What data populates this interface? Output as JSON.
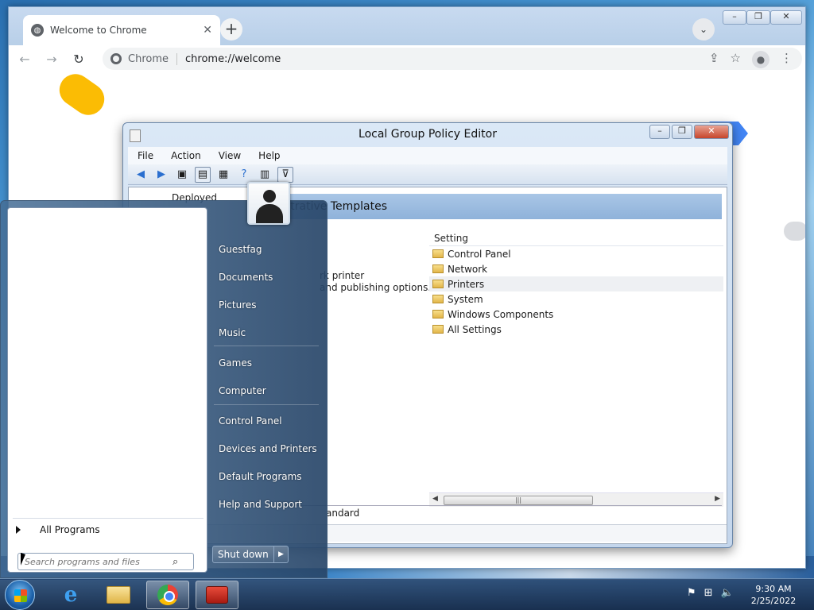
{
  "chrome": {
    "tab_title": "Welcome to Chrome",
    "site_label": "Chrome",
    "url": "chrome://welcome",
    "icons": [
      "back-icon",
      "forward-icon",
      "reload-icon",
      "share-icon",
      "star-icon",
      "profile-icon",
      "menu-icon"
    ]
  },
  "gpe": {
    "title": "Local Group Policy Editor",
    "menu": [
      "File",
      "Action",
      "View",
      "Help"
    ],
    "tree_item": "Deployed",
    "header": "strative Templates",
    "description_lines": [
      "rk printer",
      "and publishing options."
    ],
    "settings_header": "Setting",
    "settings": [
      "Control Panel",
      "Network",
      "Printers",
      "System",
      "Windows Components",
      "All Settings"
    ],
    "selected_setting": "Printers",
    "tab_label": "andard"
  },
  "startmenu": {
    "right_items": [
      "Guestfag",
      "Documents",
      "Pictures",
      "Music",
      "Games",
      "Computer",
      "Control Panel",
      "Devices and Printers",
      "Default Programs",
      "Help and Support"
    ],
    "all_programs": "All Programs",
    "search_placeholder": "Search programs and files",
    "shutdown": "Shut down"
  },
  "taskbar": {
    "time": "9:30 AM",
    "date": "2/25/2022"
  }
}
